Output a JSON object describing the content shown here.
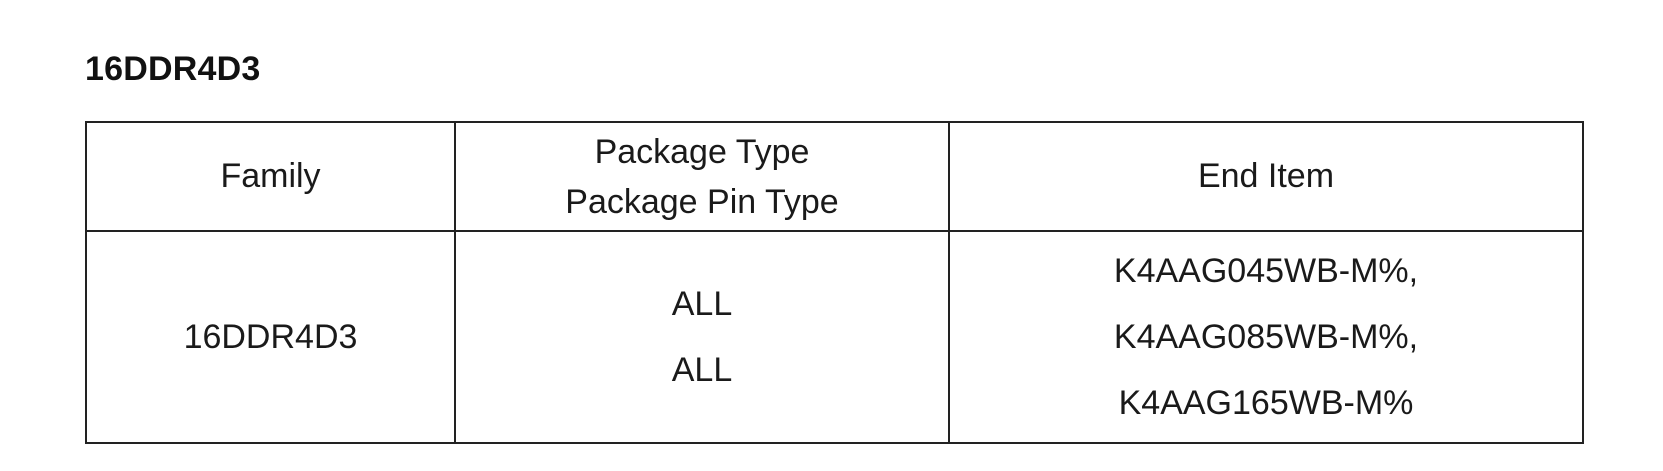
{
  "section_title": "16DDR4D3",
  "table": {
    "headers": {
      "family": "Family",
      "package_type": "Package Type",
      "package_pin_type": "Package Pin Type",
      "end_item": "End Item"
    },
    "rows": [
      {
        "family": "16DDR4D3",
        "package_type": "ALL",
        "package_pin_type": "ALL",
        "end_items": [
          "K4AAG045WB-M%,",
          "K4AAG085WB-M%,",
          "K4AAG165WB-M%"
        ]
      }
    ]
  }
}
